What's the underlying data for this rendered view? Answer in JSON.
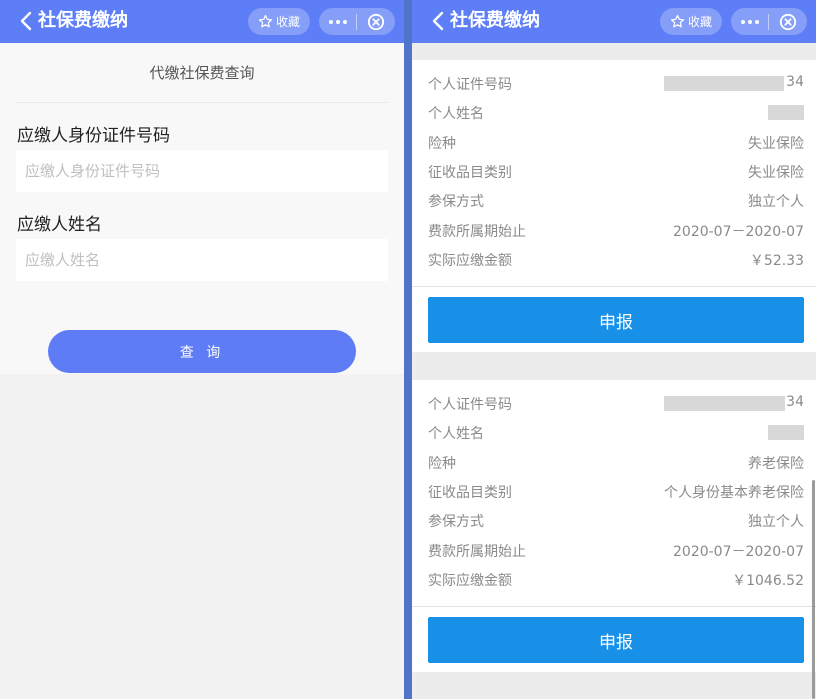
{
  "left": {
    "header": {
      "title": "社保费缴纳",
      "fav_label": "收藏"
    },
    "form": {
      "heading": "代缴社保费查询",
      "id_label": "应缴人身份证件号码",
      "id_placeholder": "应缴人身份证件号码",
      "name_label": "应缴人姓名",
      "name_placeholder": "应缴人姓名",
      "query_label": "查 询"
    }
  },
  "right": {
    "header": {
      "title": "社保费缴纳",
      "fav_label": "收藏"
    },
    "records": [
      {
        "rows": [
          {
            "label": "个人证件号码",
            "value": "34"
          },
          {
            "label": "个人姓名",
            "value": ""
          },
          {
            "label": "险种",
            "value": "失业保险"
          },
          {
            "label": "征收品目类别",
            "value": "失业保险"
          },
          {
            "label": "参保方式",
            "value": "独立个人"
          },
          {
            "label": "费款所属期始止",
            "value": "2020-07－2020-07"
          },
          {
            "label": "实际应缴金额",
            "value": "￥52.33"
          }
        ],
        "button_label": "申报"
      },
      {
        "rows": [
          {
            "label": "个人证件号码",
            "value": "34"
          },
          {
            "label": "个人姓名",
            "value": ""
          },
          {
            "label": "险种",
            "value": "养老保险"
          },
          {
            "label": "征收品目类别",
            "value": "个人身份基本养老保险"
          },
          {
            "label": "参保方式",
            "value": "独立个人"
          },
          {
            "label": "费款所属期始止",
            "value": "2020-07－2020-07"
          },
          {
            "label": "实际应缴金额",
            "value": "￥1046.52"
          }
        ],
        "button_label": "申报"
      }
    ]
  },
  "colors": {
    "header": "#5d7ef6",
    "query_button": "#5e7cf6",
    "report_button": "#1890e8"
  },
  "icons": [
    "chevron-left-icon",
    "star-icon",
    "more-icon",
    "close-circle-icon"
  ]
}
